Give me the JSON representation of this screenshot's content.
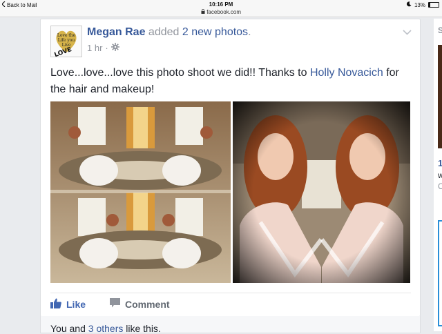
{
  "statusbar": {
    "back_label": "Back to Mail",
    "time": "10:16 PM",
    "url": "facebook.com",
    "battery": "13%"
  },
  "post": {
    "author": "Megan Rae",
    "action_text": "added",
    "action_link": "2 new photos",
    "action_end": ".",
    "time": "1 hr",
    "time_sep": "·",
    "text_before": "Love...love...love this photo shoot we did!! Thanks to ",
    "text_link": "Holly Novacich",
    "text_after": " for the hair and makeup!",
    "avatar_lines": [
      "Love the",
      "Life you",
      "Live"
    ],
    "avatar_word": "LOVE"
  },
  "actions": {
    "like": "Like",
    "comment": "Comment"
  },
  "likes": {
    "prefix": "You and ",
    "link": "3 others",
    "suffix": " like this."
  },
  "right_column": {
    "heading": "S",
    "number": "1",
    "line2": "w",
    "line3": "C"
  },
  "colors": {
    "facebook_blue": "#365899",
    "like_blue": "#4267b2",
    "meta_gray": "#90949c"
  }
}
